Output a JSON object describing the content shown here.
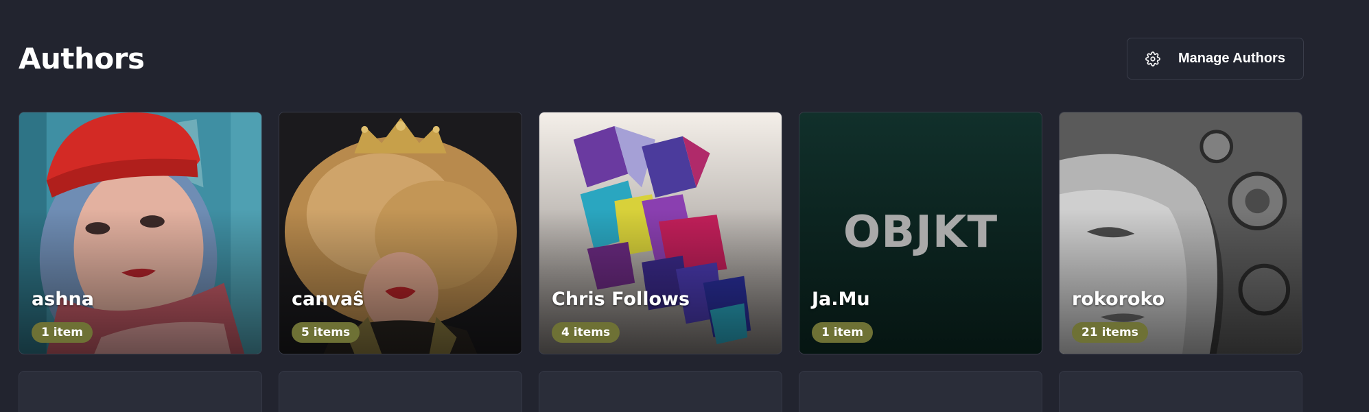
{
  "page": {
    "title": "Authors"
  },
  "toolbar": {
    "manage_label": "Manage Authors",
    "manage_icon": "gear-icon"
  },
  "colors": {
    "background": "#22242f",
    "badge": "#6e7135",
    "card_border": "#3a3d4a"
  },
  "authors": [
    {
      "name": "ashna",
      "count_label": "1 item"
    },
    {
      "name": "canvaŝ",
      "count_label": "5 items"
    },
    {
      "name": "Chris Follows",
      "count_label": "4 items"
    },
    {
      "name": "Ja.Mu",
      "count_label": "1 item",
      "placeholder_text": "OBJKT"
    },
    {
      "name": "rokoroko",
      "count_label": "21 items"
    }
  ]
}
